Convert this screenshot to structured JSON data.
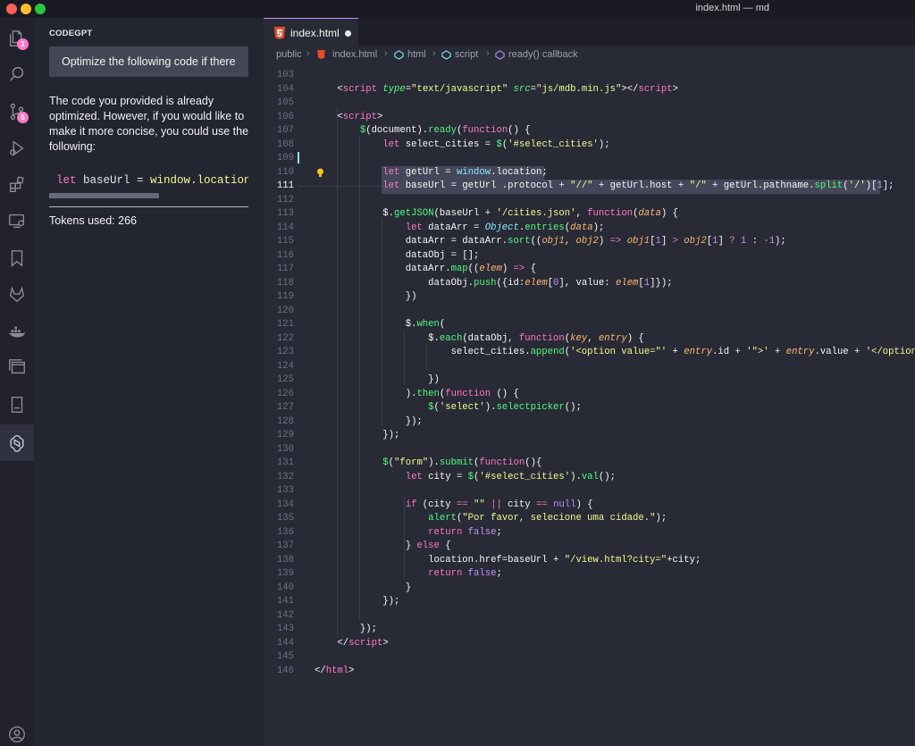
{
  "window": {
    "title": "index.html — md"
  },
  "activity_bar": {
    "explorer_badge": "1",
    "scm_badge": "5"
  },
  "side_panel": {
    "title": "CODEGPT",
    "prompt": "Optimize the following code if there",
    "answer": "The code you provided is already optimized. However, if you would like to make it more concise, you could use the following:",
    "answer_code_kw": "let",
    "answer_code_rest": " baseUrl = ",
    "answer_code_str": "window.location.",
    "tokens": "Tokens used: 266"
  },
  "editor": {
    "tab_label": "index.html",
    "breadcrumb": {
      "folder": "public",
      "file": "index.html",
      "el1": "html",
      "el2": "script",
      "el3": "ready() callback"
    },
    "line_numbers": [
      "103",
      "104",
      "105",
      "106",
      "107",
      "108",
      "109",
      "110",
      "111",
      "112",
      "113",
      "114",
      "115",
      "116",
      "117",
      "118",
      "119",
      "120",
      "121",
      "122",
      "123",
      "124",
      "125",
      "126",
      "127",
      "128",
      "129",
      "130",
      "131",
      "132",
      "133",
      "134",
      "135",
      "136",
      "137",
      "138",
      "139",
      "140",
      "141",
      "142",
      "143",
      "144",
      "145",
      "146"
    ]
  }
}
